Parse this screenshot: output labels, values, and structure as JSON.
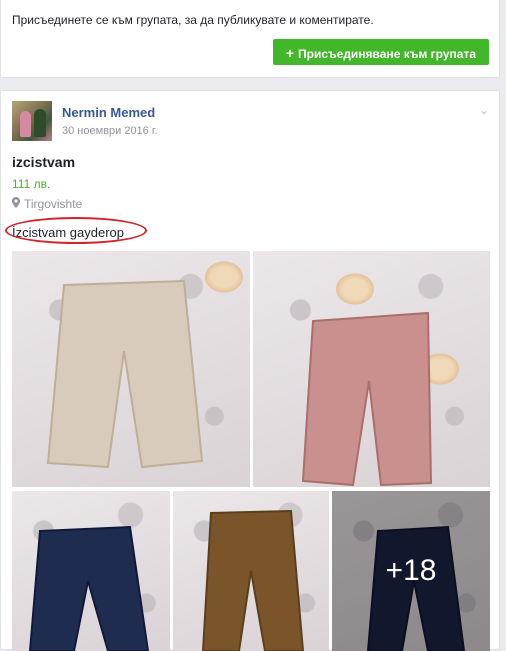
{
  "join": {
    "prompt": "Присъединете се към групата, за да публикувате и коментирате.",
    "button_icon": "plus-icon",
    "button_label": "Присъединяване към групата"
  },
  "post": {
    "author": "Nermin Memed",
    "date": "30 ноември 2016 г.",
    "title": "izcistvam",
    "price": "111 лв.",
    "location": "Tirgovishte",
    "description": "İzcistvam gayderop",
    "more_photos": "+18"
  },
  "colors": {
    "accent_green": "#42b72a",
    "link_blue": "#365899",
    "annotation_red": "#d4242a"
  },
  "photos": [
    {
      "name": "photo-beige-pants",
      "color": "#d8cbbb",
      "dark": "#bfae98"
    },
    {
      "name": "photo-pink-pants",
      "color": "#c9908d",
      "dark": "#a96f6c"
    },
    {
      "name": "photo-dark-jeans",
      "color": "#1e2c4f",
      "dark": "#11193a"
    },
    {
      "name": "photo-brown-pants",
      "color": "#7a552a",
      "dark": "#5c3e1c"
    },
    {
      "name": "photo-jeans-more",
      "color": "#1b2646",
      "dark": "#101634"
    }
  ]
}
